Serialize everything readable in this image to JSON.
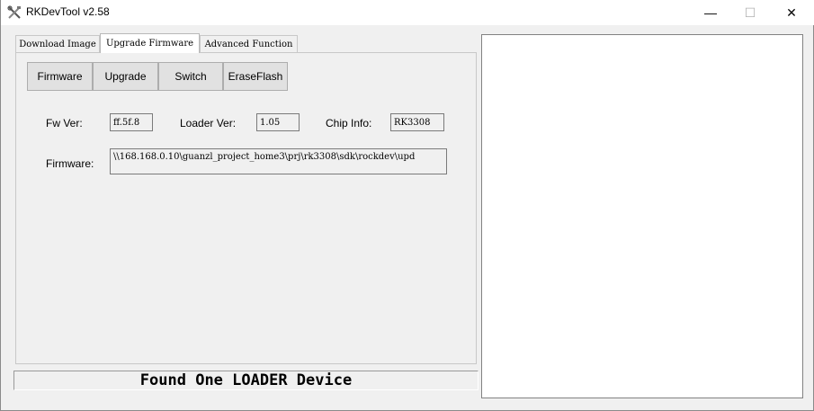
{
  "window": {
    "title": "RKDevTool v2.58",
    "controls": {
      "minimize": "—",
      "maximize": "☐",
      "close": "✕"
    }
  },
  "tabs": [
    {
      "label": "Download Image",
      "active": false
    },
    {
      "label": "Upgrade Firmware",
      "active": true
    },
    {
      "label": "Advanced Function",
      "active": false
    }
  ],
  "buttons": {
    "firmware": "Firmware",
    "upgrade": "Upgrade",
    "switch": "Switch",
    "eraseflash": "EraseFlash"
  },
  "info": {
    "fw_ver_label": "Fw Ver:",
    "fw_ver_value": "ff.5f.8",
    "loader_ver_label": "Loader Ver:",
    "loader_ver_value": "1.05",
    "chip_info_label": "Chip Info:",
    "chip_info_value": "RK3308",
    "firmware_label": "Firmware:",
    "firmware_path": "\\\\168.168.0.10\\guanzl_project_home3\\prj\\rk3308\\sdk\\rockdev\\upd"
  },
  "status": {
    "message": "Found One LOADER Device"
  },
  "icons": {
    "app": "tools-icon"
  }
}
